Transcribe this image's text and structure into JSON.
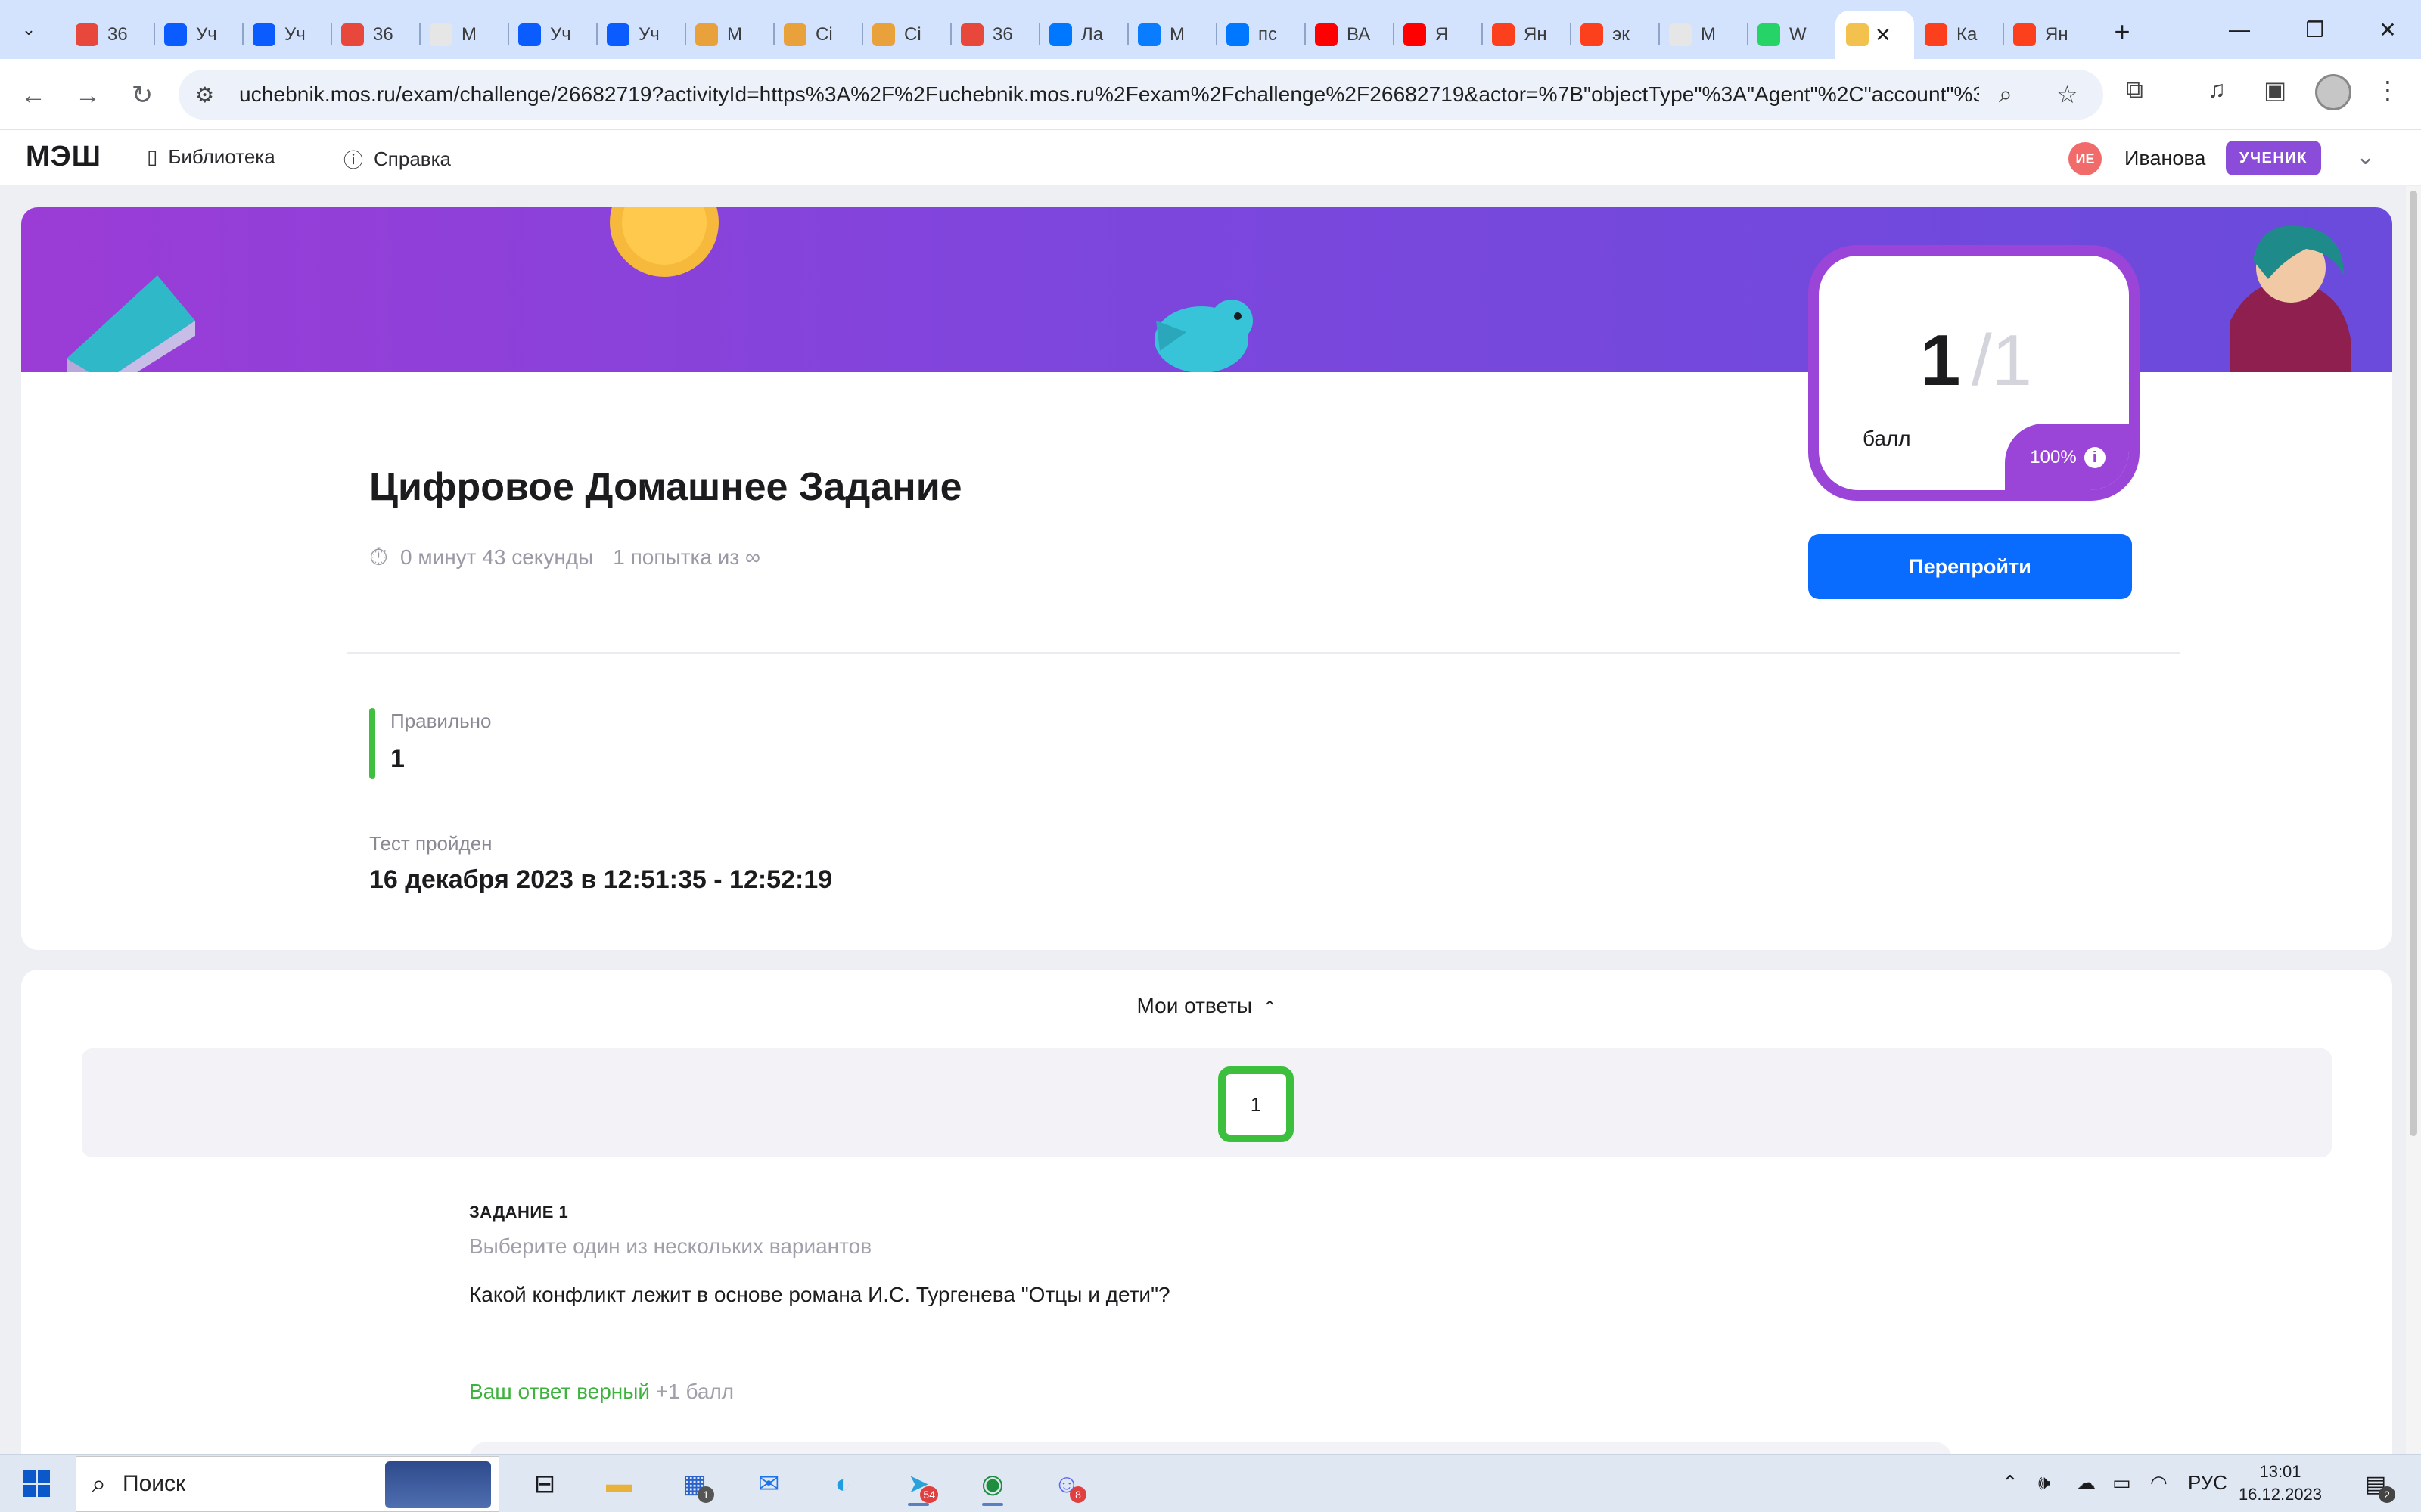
{
  "browser": {
    "tabs": [
      {
        "title": "36",
        "favicon": "yandex-mail",
        "color": "#e8483c"
      },
      {
        "title": "Уч",
        "favicon": "zoom",
        "color": "#0b5cff"
      },
      {
        "title": "Уч",
        "favicon": "zoom",
        "color": "#0b5cff"
      },
      {
        "title": "36",
        "favicon": "yandex-mail",
        "color": "#e8483c"
      },
      {
        "title": "М",
        "favicon": "blank",
        "color": "#e6e6e6"
      },
      {
        "title": "Уч",
        "favicon": "zoom",
        "color": "#0b5cff"
      },
      {
        "title": "Уч",
        "favicon": "zoom",
        "color": "#0b5cff"
      },
      {
        "title": "М",
        "favicon": "grid",
        "color": "#e9a23b"
      },
      {
        "title": "Ci",
        "favicon": "grid",
        "color": "#e9a23b"
      },
      {
        "title": "Ci",
        "favicon": "grid",
        "color": "#e9a23b"
      },
      {
        "title": "36",
        "favicon": "yandex-mail",
        "color": "#e8483c"
      },
      {
        "title": "Ла",
        "favicon": "vk",
        "color": "#0077ff"
      },
      {
        "title": "М",
        "favicon": "chat",
        "color": "#0a7cff"
      },
      {
        "title": "пс",
        "favicon": "vk",
        "color": "#0077ff"
      },
      {
        "title": "ВА",
        "favicon": "youtube",
        "color": "#ff0000"
      },
      {
        "title": "Я",
        "favicon": "youtube",
        "color": "#ff0000"
      },
      {
        "title": "Ян",
        "favicon": "yandex",
        "color": "#fc3f1d"
      },
      {
        "title": "эк",
        "favicon": "yandex",
        "color": "#fc3f1d"
      },
      {
        "title": "М",
        "favicon": "blank",
        "color": "#e6e6e6"
      },
      {
        "title": "W",
        "favicon": "whatsapp",
        "color": "#25d366"
      },
      {
        "title": "",
        "favicon": "book",
        "color": "#f2c14e",
        "active": true
      },
      {
        "title": "Ка",
        "favicon": "yandex",
        "color": "#fc3f1d"
      },
      {
        "title": "Ян",
        "favicon": "yandex",
        "color": "#fc3f1d"
      }
    ],
    "url": "uchebnik.mos.ru/exam/challenge/26682719?activityId=https%3A%2F%2Fuchebnik.mos.ru%2Fexam%2Fchallenge%2F26682719&actor=%7B\"objectType\"%3A\"Agent\"%2C\"account\"%3A%..."
  },
  "header": {
    "logo": "МЭШ",
    "nav": [
      {
        "label": "Библиотека",
        "icon": "book-icon"
      },
      {
        "label": "Справка",
        "icon": "help-icon"
      }
    ],
    "user_initials": "ИЕ",
    "user_name": "Иванова",
    "role": "УЧЕНИК"
  },
  "result": {
    "title": "Цифровое Домашнее Задание",
    "duration": "0 минут 43 секунды",
    "attempts": "1 попытка из ∞",
    "score": "1",
    "score_total": "/1",
    "score_label": "балл",
    "percent": "100%",
    "retry_label": "Перепройти",
    "correct_label": "Правильно",
    "correct_value": "1",
    "completed_label": "Тест пройден",
    "completed_value": "16 декабря 2023 в 12:51:35 - 12:52:19"
  },
  "answers": {
    "heading": "Мои ответы",
    "questions": [
      "1"
    ],
    "task_number": "ЗАДАНИЕ 1",
    "task_hint": "Выберите один из нескольких вариантов",
    "task_question": "Какой конфликт лежит в основе романа И.С. Тургенева \"Отцы и дети\"?",
    "answer_status": "Ваш ответ верный",
    "answer_points": "+1 балл"
  },
  "taskbar": {
    "search_label": "Поиск",
    "lang": "РУС",
    "time": "13:01",
    "date": "16.12.2023",
    "notifications": "2",
    "store_badge": "1",
    "telegram_badge": "54",
    "discord_badge": "8"
  },
  "colors": {
    "accent_blue": "#0a6cff",
    "purple": "#9b44d8",
    "success": "#3cbf3c"
  }
}
